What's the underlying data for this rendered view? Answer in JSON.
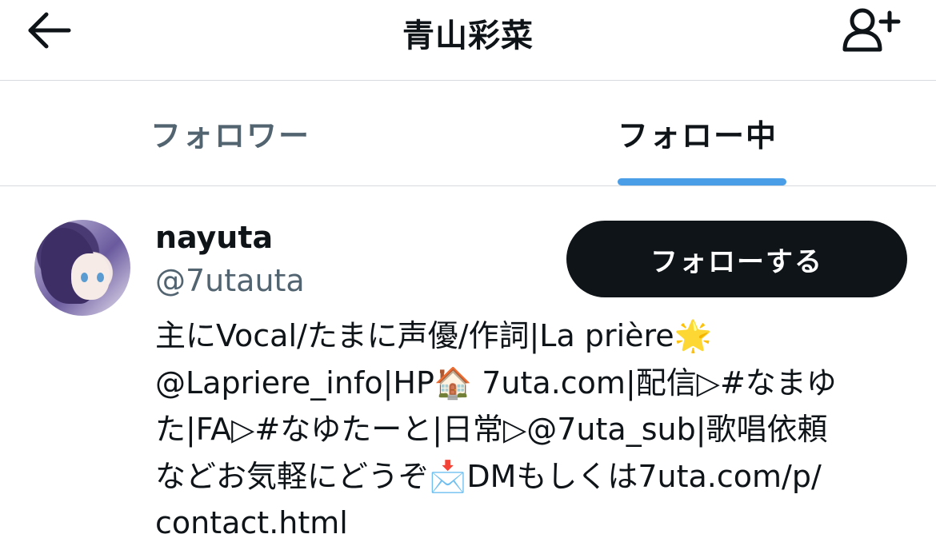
{
  "header": {
    "title": "青山彩菜",
    "back_icon": "arrow-left-icon",
    "add_user_icon": "person-add-icon"
  },
  "tabs": [
    {
      "label": "フォロワー",
      "active": false
    },
    {
      "label": "フォロー中",
      "active": true
    }
  ],
  "accent_color": "#4a9ee8",
  "user": {
    "name": "nayuta",
    "handle": "@7utauta",
    "follow_label": "フォローする",
    "bio": "主にVocal/たまに声優/作詞|La prière🌟\n@Lapriere_info|HP🏠 7uta.com|配信▷#なまゆ\nた|FA▷#なゆたーと|日常▷@7uta_sub|歌唱依頼\nなどお気軽にどうぞ📩DMもしくは7uta.com/p/\ncontact.html"
  }
}
